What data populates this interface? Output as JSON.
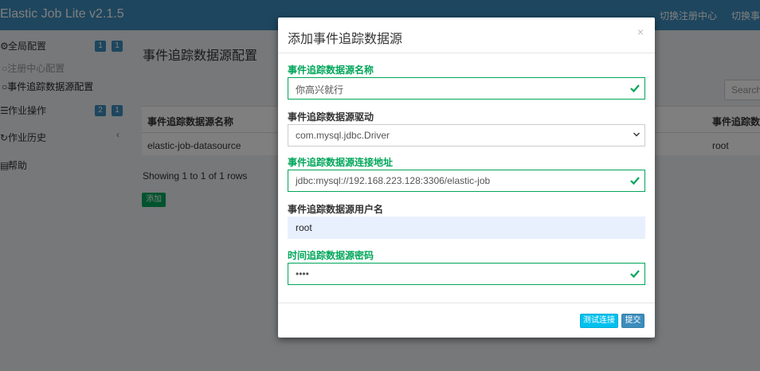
{
  "app": {
    "title": "Elastic Job Lite v2.1.5"
  },
  "topnav": {
    "registry_link": "切换注册中心",
    "event_link": "切换事件"
  },
  "sidebar": {
    "global_config": {
      "label": "全局配置",
      "badges": [
        "1",
        "1"
      ]
    },
    "registry_config": "注册中心配置",
    "datasource_config": "事件追踪数据源配置",
    "job_ops": {
      "label": "作业操作",
      "badges": [
        "2",
        "1"
      ]
    },
    "job_history": "作业历史",
    "help": "帮助"
  },
  "main": {
    "page_title": "事件追踪数据源配置",
    "search_placeholder": "Search",
    "table": {
      "columns": [
        "事件追踪数据源名称",
        "事件追踪数据"
      ],
      "rows": [
        [
          "elastic-job-datasource",
          "root"
        ]
      ]
    },
    "showing": "Showing 1 to 1 of 1 rows",
    "add_button": "添加"
  },
  "modal": {
    "title": "添加事件追踪数据源",
    "close": "×",
    "fields": {
      "name": {
        "label": "事件追踪数据源名称",
        "value": "你高兴就行"
      },
      "driver": {
        "label": "事件追踪数据源驱动",
        "value": "com.mysql.jdbc.Driver"
      },
      "url": {
        "label": "事件追踪数据源连接地址",
        "value": "jdbc:mysql://192.168.223.128:3306/elastic-job"
      },
      "username": {
        "label": "事件追踪数据源用户名",
        "value": "root"
      },
      "password": {
        "label": "时间追踪数据源密码",
        "value": "••••"
      }
    },
    "test_button": "测试连接",
    "submit_button": "提交"
  },
  "colors": {
    "brand": "#3c8dbc",
    "success": "#00a65a",
    "info": "#00c0ef"
  }
}
